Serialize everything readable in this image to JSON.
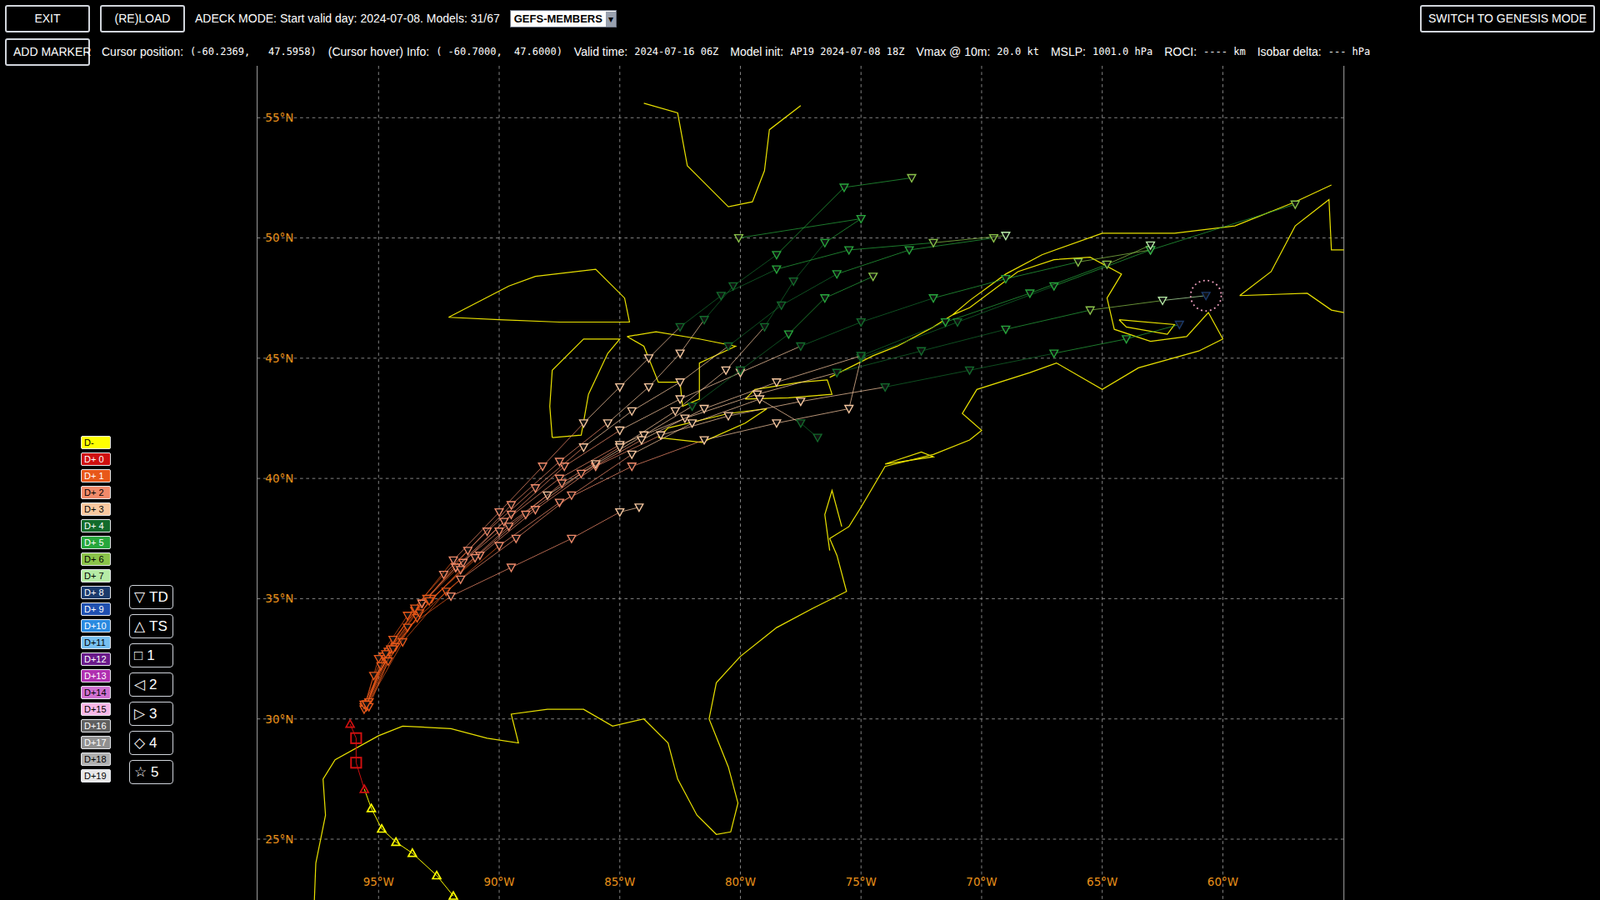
{
  "toolbar": {
    "exit_button": "EXIT",
    "reload_button": "(RE)LOAD",
    "mode_text": "ADECK MODE: Start valid day: 2024-07-08. Models: 31/67",
    "model_select": {
      "value": "GEFS-MEMBERS",
      "arrow": "▾"
    },
    "genesis_button": "SWITCH TO GENESIS MODE"
  },
  "info_bar": {
    "add_marker_button": "ADD MARKER",
    "fields": [
      {
        "label": "Cursor position:",
        "value": "(-60.2369,   47.5958)"
      },
      {
        "label": "(Cursor hover) Info:",
        "value": "( -60.7000,  47.6000)"
      },
      {
        "label": "Valid time:",
        "value": "2024-07-16 06Z"
      },
      {
        "label": "Model init:",
        "value": "AP19 2024-07-08 18Z"
      },
      {
        "label": "Vmax @ 10m:",
        "value": "20.0 kt"
      },
      {
        "label": "MSLP:",
        "value": "1001.0 hPa"
      },
      {
        "label": "ROCI:",
        "value": "---- km"
      },
      {
        "label": "Isobar delta:",
        "value": "--- hPa"
      }
    ]
  },
  "map": {
    "lat_labels": [
      {
        "label": "55°N",
        "lat": 55
      },
      {
        "label": "50°N",
        "lat": 50
      },
      {
        "label": "45°N",
        "lat": 45
      },
      {
        "label": "40°N",
        "lat": 40
      },
      {
        "label": "35°N",
        "lat": 35
      },
      {
        "label": "30°N",
        "lat": 30
      },
      {
        "label": "25°N",
        "lat": 25
      }
    ],
    "lon_labels": [
      {
        "label": "95°W",
        "lon": -95
      },
      {
        "label": "90°W",
        "lon": -90
      },
      {
        "label": "85°W",
        "lon": -85
      },
      {
        "label": "80°W",
        "lon": -80
      },
      {
        "label": "75°W",
        "lon": -75
      },
      {
        "label": "70°W",
        "lon": -70
      },
      {
        "label": "65°W",
        "lon": -65
      },
      {
        "label": "60°W",
        "lon": -60
      }
    ],
    "best_track": [
      {
        "lon": -91.9,
        "lat": 22.64,
        "day": -1,
        "kind": "TS"
      },
      {
        "lon": -92.59,
        "lat": 23.49,
        "day": -1,
        "kind": "TS"
      },
      {
        "lon": -93.6,
        "lat": 24.42,
        "day": -1,
        "kind": "TS"
      },
      {
        "lon": -94.28,
        "lat": 24.88,
        "day": -1,
        "kind": "TS"
      },
      {
        "lon": -94.87,
        "lat": 25.43,
        "day": -1,
        "kind": "TS"
      },
      {
        "lon": -95.3,
        "lat": 26.28,
        "day": -1,
        "kind": "TS"
      },
      {
        "lon": -95.59,
        "lat": 27.08,
        "day": 0,
        "kind": "TS"
      },
      {
        "lon": -95.93,
        "lat": 28.18,
        "day": 0,
        "kind": "1"
      },
      {
        "lon": -95.93,
        "lat": 29.2,
        "day": 0,
        "kind": "1"
      },
      {
        "lon": -96.18,
        "lat": 29.79,
        "day": 0,
        "kind": "TS"
      }
    ],
    "members": [
      {
        "kind": "TD",
        "points": [
          [
            -95.5,
            30.6,
            1
          ],
          [
            -94.6,
            32.8,
            1
          ],
          [
            -93.2,
            34.8,
            1
          ],
          [
            -91.5,
            36.5,
            2
          ],
          [
            -89.5,
            38.5,
            2
          ],
          [
            -87.3,
            40.5,
            2
          ],
          [
            -85,
            42,
            3
          ],
          [
            -82.5,
            43.3,
            3
          ],
          [
            -80,
            44.4,
            3
          ],
          [
            -77.5,
            45.5,
            4
          ],
          [
            -75,
            46.5,
            4
          ],
          [
            -72,
            47.5,
            5
          ],
          [
            -69,
            48.3,
            5
          ],
          [
            -66,
            49,
            6
          ],
          [
            -63,
            49.5,
            7
          ]
        ]
      },
      {
        "kind": "TD",
        "points": [
          [
            -95.6,
            30.5,
            1
          ],
          [
            -95,
            32.5,
            1
          ],
          [
            -93.8,
            34.3,
            1
          ],
          [
            -92.3,
            36,
            2
          ],
          [
            -90.5,
            37.8,
            2
          ],
          [
            -88.5,
            39.6,
            2
          ],
          [
            -86.5,
            41.3,
            3
          ],
          [
            -84.5,
            42.8,
            3
          ],
          [
            -82.5,
            44,
            3
          ],
          [
            -80.5,
            45.5,
            4
          ],
          [
            -78.3,
            47.2,
            4
          ],
          [
            -76,
            48.5,
            5
          ],
          [
            -73,
            49.5,
            5
          ],
          [
            -69.5,
            50,
            6
          ]
        ]
      },
      {
        "kind": "TD",
        "points": [
          [
            -95.4,
            30.7,
            1
          ],
          [
            -94.3,
            33,
            1
          ],
          [
            -92.8,
            35,
            1
          ],
          [
            -90.8,
            36.8,
            2
          ],
          [
            -88.5,
            38.7,
            2
          ],
          [
            -86,
            40.5,
            2
          ],
          [
            -83.3,
            41.8,
            3
          ],
          [
            -80.5,
            42.6,
            3
          ],
          [
            -77.5,
            43.2,
            3
          ],
          [
            -74,
            43.8,
            4
          ],
          [
            -70.5,
            44.5,
            4
          ],
          [
            -67,
            45.2,
            5
          ],
          [
            -64,
            45.8,
            5
          ],
          [
            -61.8,
            46.4,
            8
          ]
        ]
      },
      {
        "kind": "TD",
        "points": [
          [
            -95.5,
            30.6,
            1
          ],
          [
            -94.8,
            32.6,
            1
          ],
          [
            -93.5,
            34.5,
            1
          ],
          [
            -91.8,
            36.3,
            2
          ],
          [
            -89.8,
            38.2,
            2
          ],
          [
            -87.5,
            40,
            2
          ],
          [
            -85,
            41.4,
            3
          ],
          [
            -82.3,
            42.5,
            3
          ],
          [
            -79.3,
            43.5,
            3
          ],
          [
            -76,
            44.4,
            4
          ],
          [
            -72.5,
            45.3,
            4
          ],
          [
            -69,
            46.2,
            5
          ],
          [
            -65.5,
            47,
            6
          ],
          [
            -62.5,
            47.4,
            7
          ],
          [
            -60.7,
            47.6,
            8
          ]
        ]
      },
      {
        "kind": "TD",
        "points": [
          [
            -95.6,
            30.4,
            1
          ],
          [
            -95.2,
            31.8,
            1
          ],
          [
            -94.4,
            33.3,
            1
          ],
          [
            -93.2,
            34.8,
            2
          ],
          [
            -91.8,
            36.3,
            2
          ],
          [
            -90,
            37.8,
            2
          ],
          [
            -88,
            39.3,
            3
          ],
          [
            -86,
            40.6,
            3
          ],
          [
            -84,
            41.8,
            3
          ],
          [
            -82,
            43,
            4
          ],
          [
            -80,
            44.5,
            4
          ],
          [
            -78,
            46,
            5
          ],
          [
            -76.5,
            47.5,
            5
          ],
          [
            -74.5,
            48.4,
            6
          ]
        ]
      },
      {
        "kind": "TD",
        "points": [
          [
            -95.5,
            30.6,
            1
          ],
          [
            -94.5,
            32.9,
            1
          ],
          [
            -93,
            35,
            1
          ],
          [
            -91.3,
            37,
            2
          ],
          [
            -89.5,
            38.9,
            2
          ],
          [
            -87.5,
            40.7,
            2
          ],
          [
            -85.5,
            42.3,
            3
          ],
          [
            -83.8,
            43.8,
            3
          ],
          [
            -82.5,
            45.2,
            3
          ],
          [
            -81.5,
            46.6,
            4
          ],
          [
            -80.3,
            48,
            4
          ],
          [
            -78.5,
            49.3,
            5
          ],
          [
            -75.7,
            52.1,
            5
          ],
          [
            -72.9,
            52.5,
            6
          ]
        ]
      },
      {
        "kind": "TD",
        "points": [
          [
            -95.4,
            30.7,
            1
          ],
          [
            -94,
            33.2,
            1
          ],
          [
            -92.2,
            35.3,
            1
          ],
          [
            -90,
            37.2,
            2
          ],
          [
            -87.5,
            39,
            2
          ],
          [
            -84.5,
            40.5,
            2
          ],
          [
            -81.5,
            41.6,
            3
          ],
          [
            -78.5,
            42.3,
            3
          ],
          [
            -75.5,
            42.9,
            3
          ],
          [
            -75,
            45,
            4
          ],
          [
            -71,
            46.5,
            4
          ],
          [
            -67,
            48,
            5
          ],
          [
            -63,
            49.5,
            5
          ],
          [
            -57,
            51.4,
            6
          ]
        ]
      },
      {
        "kind": "TD",
        "points": [
          [
            -95.5,
            30.5,
            1
          ],
          [
            -94.9,
            32.2,
            1
          ],
          [
            -93.8,
            33.8,
            1
          ],
          [
            -92,
            35.1,
            2
          ],
          [
            -89.5,
            36.3,
            2
          ],
          [
            -87,
            37.5,
            2
          ],
          [
            -85,
            38.6,
            3
          ],
          [
            -84.2,
            38.8,
            3
          ]
        ]
      },
      {
        "kind": "TD",
        "points": [
          [
            -95.6,
            30.6,
            1
          ],
          [
            -94.7,
            32.5,
            1
          ],
          [
            -93.4,
            34.2,
            1
          ],
          [
            -91.6,
            35.8,
            2
          ],
          [
            -89.3,
            37.5,
            2
          ],
          [
            -87,
            39.3,
            2
          ],
          [
            -84.5,
            41,
            3
          ],
          [
            -82,
            42.3,
            3
          ],
          [
            -79.2,
            43.3,
            3
          ],
          [
            -77.5,
            42.3,
            4
          ],
          [
            -76.8,
            41.7,
            4
          ]
        ]
      },
      {
        "kind": "TD",
        "points": [
          [
            -95.4,
            30.5,
            1
          ],
          [
            -94.6,
            32.4,
            1
          ],
          [
            -93.3,
            34.4,
            1
          ],
          [
            -91.6,
            36.2,
            2
          ],
          [
            -89.6,
            38,
            2
          ],
          [
            -87.4,
            39.8,
            2
          ],
          [
            -85,
            41.3,
            3
          ],
          [
            -82.7,
            42.8,
            3
          ],
          [
            -80.6,
            44.5,
            3
          ],
          [
            -79,
            46.3,
            4
          ],
          [
            -77.8,
            48.2,
            4
          ],
          [
            -76.5,
            49.8,
            5
          ],
          [
            -75,
            50.8,
            5
          ],
          [
            -80.07,
            50,
            6
          ]
        ]
      },
      {
        "kind": "TD",
        "points": [
          [
            -95.5,
            30.6,
            1
          ],
          [
            -94.7,
            32.7,
            1
          ],
          [
            -93.5,
            34.6,
            1
          ],
          [
            -91.9,
            36.6,
            2
          ],
          [
            -90,
            38.6,
            2
          ],
          [
            -88.2,
            40.5,
            2
          ],
          [
            -86.5,
            42.3,
            3
          ],
          [
            -85,
            43.8,
            3
          ],
          [
            -83.8,
            45,
            3
          ],
          [
            -82.5,
            46.3,
            4
          ],
          [
            -80.8,
            47.6,
            4
          ],
          [
            -78.5,
            48.7,
            5
          ],
          [
            -75.5,
            49.5,
            5
          ],
          [
            -72,
            49.8,
            6
          ],
          [
            -69,
            50.1,
            7
          ]
        ]
      },
      {
        "kind": "TD",
        "points": [
          [
            -95.5,
            30.6,
            1
          ],
          [
            -94.4,
            32.9,
            1
          ],
          [
            -92.9,
            34.9,
            1
          ],
          [
            -91,
            36.7,
            2
          ],
          [
            -88.9,
            38.5,
            2
          ],
          [
            -86.6,
            40.2,
            2
          ],
          [
            -84.1,
            41.6,
            3
          ],
          [
            -81.5,
            42.9,
            3
          ],
          [
            -78.5,
            44,
            3
          ],
          [
            -75,
            45.1,
            4
          ],
          [
            -71.5,
            46.5,
            5
          ],
          [
            -68,
            47.7,
            5
          ],
          [
            -64.8,
            48.9,
            6
          ],
          [
            -63,
            49.7,
            7
          ]
        ]
      }
    ],
    "hover": {
      "lon": -60.7,
      "lat": 47.6
    }
  },
  "day_legend": [
    {
      "label": "D-",
      "day": -1,
      "color": "#ffff00"
    },
    {
      "label": "D+ 0",
      "day": 0,
      "color": "#d01010"
    },
    {
      "label": "D+ 1",
      "day": 1,
      "color": "#e8581a"
    },
    {
      "label": "D+ 2",
      "day": 2,
      "color": "#f08a6a"
    },
    {
      "label": "D+ 3",
      "day": 3,
      "color": "#f8c8a0"
    },
    {
      "label": "D+ 4",
      "day": 4,
      "color": "#136b2c"
    },
    {
      "label": "D+ 5",
      "day": 5,
      "color": "#27a63c"
    },
    {
      "label": "D+ 6",
      "day": 6,
      "color": "#8bc34a"
    },
    {
      "label": "D+ 7",
      "day": 7,
      "color": "#b6eba6"
    },
    {
      "label": "D+ 8",
      "day": 8,
      "color": "#1b3a6b"
    },
    {
      "label": "D+ 9",
      "day": 9,
      "color": "#2050b0"
    },
    {
      "label": "D+10",
      "day": 10,
      "color": "#2a8ae0"
    },
    {
      "label": "D+11",
      "day": 11,
      "color": "#78c0f0"
    },
    {
      "label": "D+12",
      "day": 12,
      "color": "#6a1a8a"
    },
    {
      "label": "D+13",
      "day": 13,
      "color": "#b030b0"
    },
    {
      "label": "D+14",
      "day": 14,
      "color": "#d070d0"
    },
    {
      "label": "D+15",
      "day": 15,
      "color": "#f8b8e8"
    },
    {
      "label": "D+16",
      "day": 16,
      "color": "#606060"
    },
    {
      "label": "D+17",
      "day": 17,
      "color": "#909090"
    },
    {
      "label": "D+18",
      "day": 18,
      "color": "#b0b0b0"
    },
    {
      "label": "D+19",
      "day": 19,
      "color": "#e8e8e8"
    }
  ],
  "intensity_legend": [
    {
      "symbol": "▽",
      "label": "TD"
    },
    {
      "symbol": "△",
      "label": "TS"
    },
    {
      "symbol": "□",
      "label": "1"
    },
    {
      "symbol": "◁",
      "label": "2"
    },
    {
      "symbol": "▷",
      "label": "3"
    },
    {
      "symbol": "◇",
      "label": "4"
    },
    {
      "symbol": "☆",
      "label": "5"
    }
  ]
}
